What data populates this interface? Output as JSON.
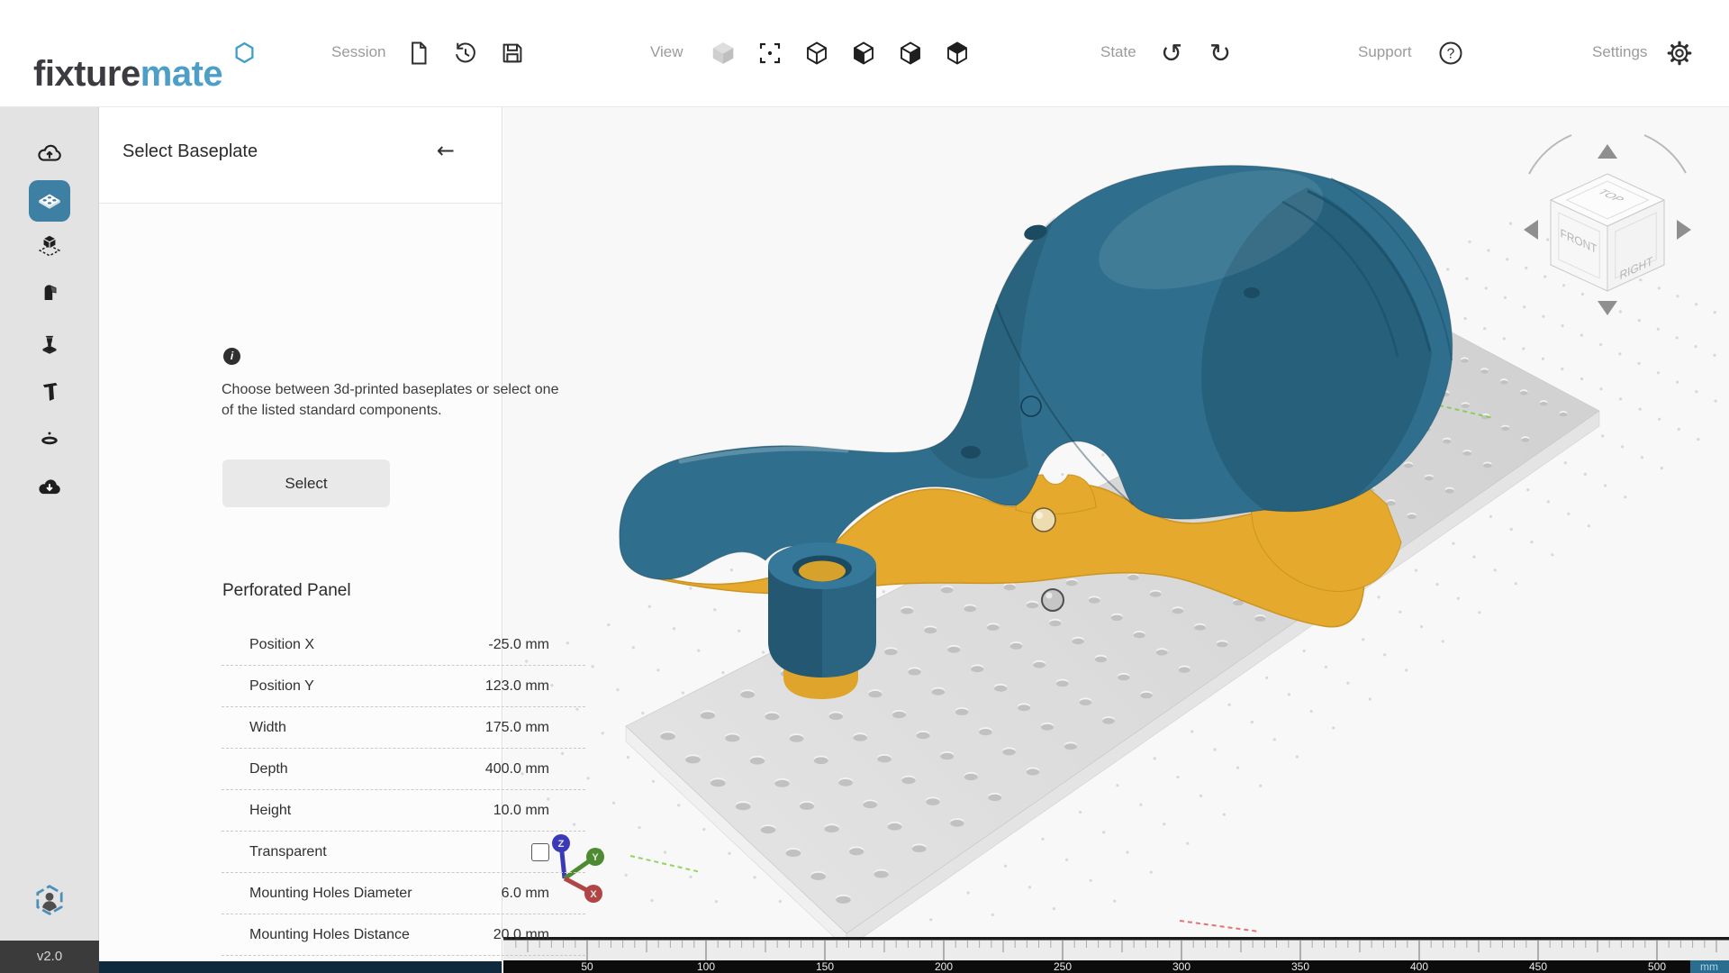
{
  "app": {
    "brand_prefix": "fixture",
    "brand_suffix": "mate",
    "version": "v2.0"
  },
  "header": {
    "session": {
      "label": "Session",
      "icons": [
        "new-file",
        "history",
        "save"
      ]
    },
    "view": {
      "label": "View",
      "icons": [
        "solid-cube",
        "focus",
        "wire-cube",
        "cube-left",
        "cube-right",
        "cube-top"
      ]
    },
    "state": {
      "label": "State",
      "icons": [
        "undo",
        "redo"
      ]
    },
    "support": {
      "label": "Support",
      "icon": "help"
    },
    "settings": {
      "label": "Settings",
      "icon": "gear"
    }
  },
  "sidebar": {
    "items": [
      {
        "name": "upload-model",
        "icon": "cloud-upload",
        "active": false
      },
      {
        "name": "select-baseplate",
        "icon": "baseplate",
        "active": true
      },
      {
        "name": "orient-part",
        "icon": "part-on-plate",
        "active": false
      },
      {
        "name": "pocket",
        "icon": "pocket",
        "active": false
      },
      {
        "name": "supports",
        "icon": "stamp",
        "active": false
      },
      {
        "name": "clamps",
        "icon": "clamp",
        "active": false
      },
      {
        "name": "labels",
        "icon": "ring",
        "active": false
      },
      {
        "name": "export",
        "icon": "cloud-download",
        "active": false
      }
    ],
    "account_icon": "user-hexagon"
  },
  "panel": {
    "title": "Select Baseplate",
    "back_glyph": "←",
    "info_glyph": "i",
    "description": "Choose between 3d-printed baseplates or select one of the listed standard components.",
    "select_button": "Select",
    "section_title": "Perforated Panel",
    "properties": [
      {
        "label": "Position X",
        "value": "-25.0 mm"
      },
      {
        "label": "Position Y",
        "value": "123.0 mm"
      },
      {
        "label": "Width",
        "value": "175.0 mm"
      },
      {
        "label": "Depth",
        "value": "400.0 mm"
      },
      {
        "label": "Height",
        "value": "10.0 mm"
      },
      {
        "label": "Transparent",
        "type": "checkbox",
        "checked": false
      },
      {
        "label": "Mounting Holes Diameter",
        "value": "6.0 mm"
      },
      {
        "label": "Mounting Holes Distance",
        "value": "20.0 mm"
      }
    ]
  },
  "viewport": {
    "view_cube": {
      "top": "TOP",
      "front": "FRONT",
      "right": "RIGHT"
    },
    "axes": [
      {
        "label": "Z",
        "color": "#3a3ab8"
      },
      {
        "label": "Y",
        "color": "#4e8a2f"
      },
      {
        "label": "X",
        "color": "#b04545"
      }
    ],
    "ruler": {
      "unit": "mm",
      "labels": [
        50,
        100,
        150,
        200,
        250,
        300,
        350,
        400,
        450,
        500
      ]
    },
    "markers": [
      {
        "name": "marker-sphere-beige",
        "color": "#ecdcb0"
      },
      {
        "name": "marker-sphere-gray",
        "color": "#c6c6c6"
      }
    ],
    "colors": {
      "part": "#2f6f8d",
      "fixture": "#e4a92d",
      "plate_far": "#d2d2d2",
      "plate_near": "#e2e2e2",
      "hole": "#c1c1c1",
      "accent": "#3e7fa4",
      "ruler_unit_bg": "#2a6d8e",
      "ruler_unit_fg": "#a8d4ea"
    }
  }
}
